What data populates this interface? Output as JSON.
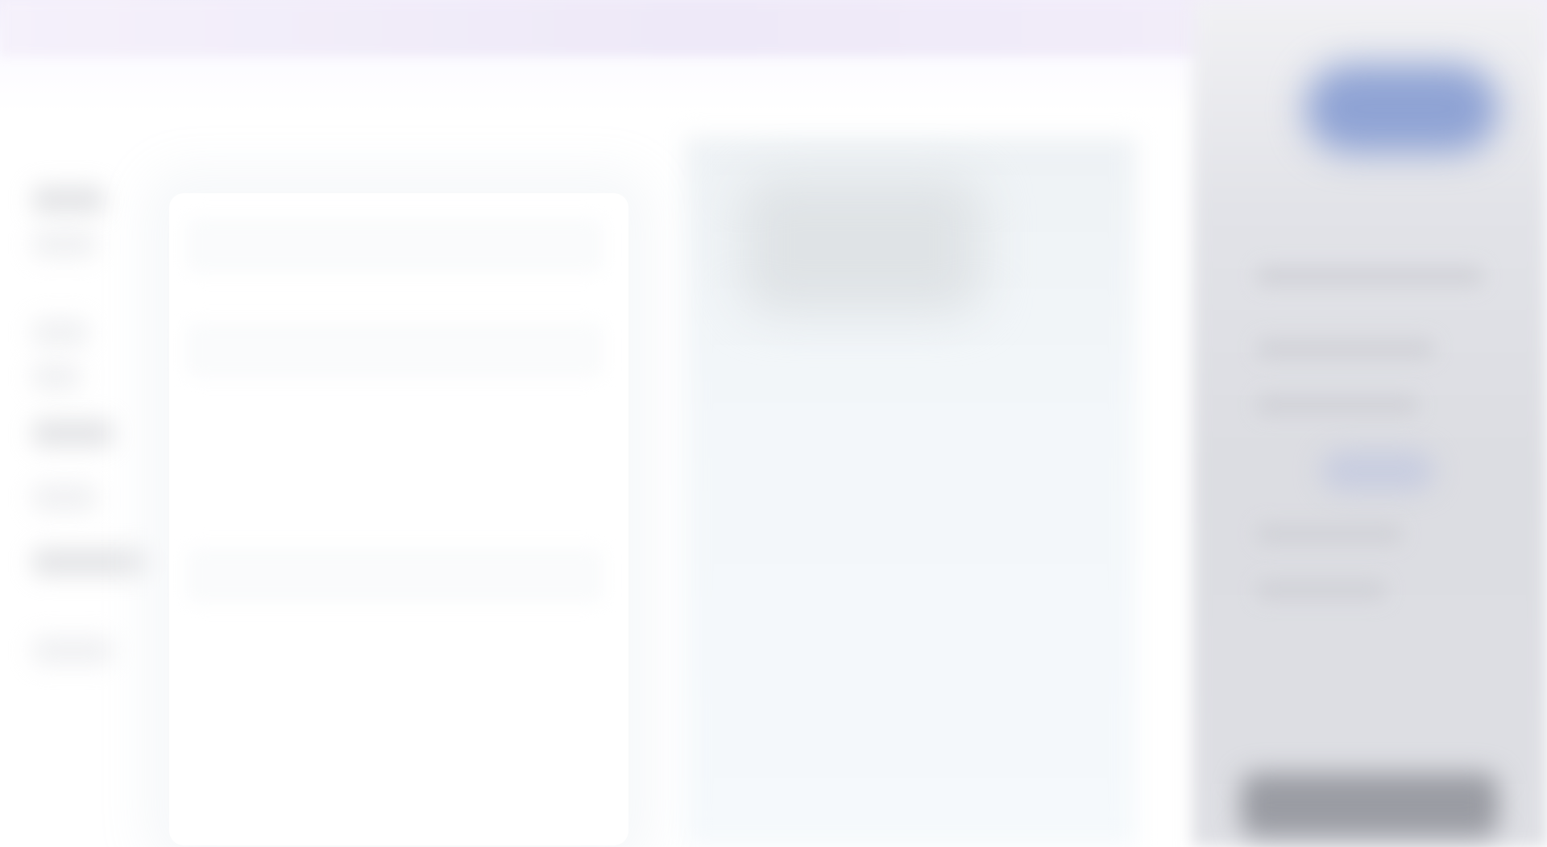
{
  "header": {
    "title": ""
  },
  "nav": {
    "items": [
      {
        "label": ""
      },
      {
        "label": ""
      },
      {
        "label": ""
      },
      {
        "label": ""
      },
      {
        "label": ""
      },
      {
        "label": ""
      },
      {
        "label": ""
      },
      {
        "label": ""
      }
    ]
  },
  "preview": {
    "title": ""
  },
  "sidebar": {
    "primary_button_label": "",
    "bottom_button_label": ""
  },
  "colors": {
    "accent": "#8fa3d4",
    "sidebar_bg": "#dcdde2",
    "preview_bg": "#f3f7fa"
  }
}
